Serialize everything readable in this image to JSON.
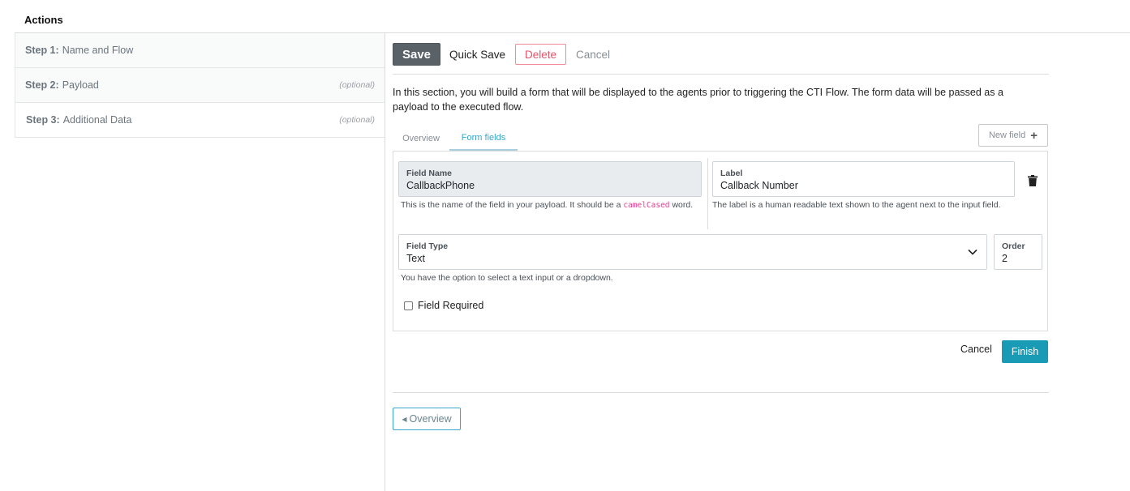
{
  "page": {
    "title": "Actions"
  },
  "steps": [
    {
      "num": "Step 1:",
      "label": "Name and Flow",
      "optional": ""
    },
    {
      "num": "Step 2:",
      "label": "Payload",
      "optional": "(optional)"
    },
    {
      "num": "Step 3:",
      "label": "Additional Data",
      "optional": "(optional)"
    }
  ],
  "toolbar": {
    "save": "Save",
    "quick_save": "Quick Save",
    "delete": "Delete",
    "cancel": "Cancel"
  },
  "intro": "In this section, you will build a form that will be displayed to the agents prior to triggering the CTI Flow. The form data will be passed as a payload to the executed flow.",
  "tabs": {
    "overview": "Overview",
    "form_fields": "Form fields",
    "new_field": "New field"
  },
  "form": {
    "field_name": {
      "label": "Field Name",
      "value": "CallbackPhone",
      "help_before": "This is the name of the field in your payload. It should be a ",
      "help_code": "camelCased",
      "help_after": " word."
    },
    "label": {
      "label": "Label",
      "value": "Callback Number",
      "help": "The label is a human readable text shown to the agent next to the input field."
    },
    "field_type": {
      "label": "Field Type",
      "value": "Text",
      "help": "You have the option to select a text input or a dropdown."
    },
    "order": {
      "label": "Order",
      "value": "2"
    },
    "required": {
      "label": "Field Required",
      "checked": false
    }
  },
  "footer": {
    "cancel": "Cancel",
    "finish": "Finish",
    "back": "Overview"
  },
  "colors": {
    "accent": "#1a9bb5",
    "save_bg": "#5a6268",
    "delete": "#e0556a",
    "code": "#e83e8c"
  }
}
